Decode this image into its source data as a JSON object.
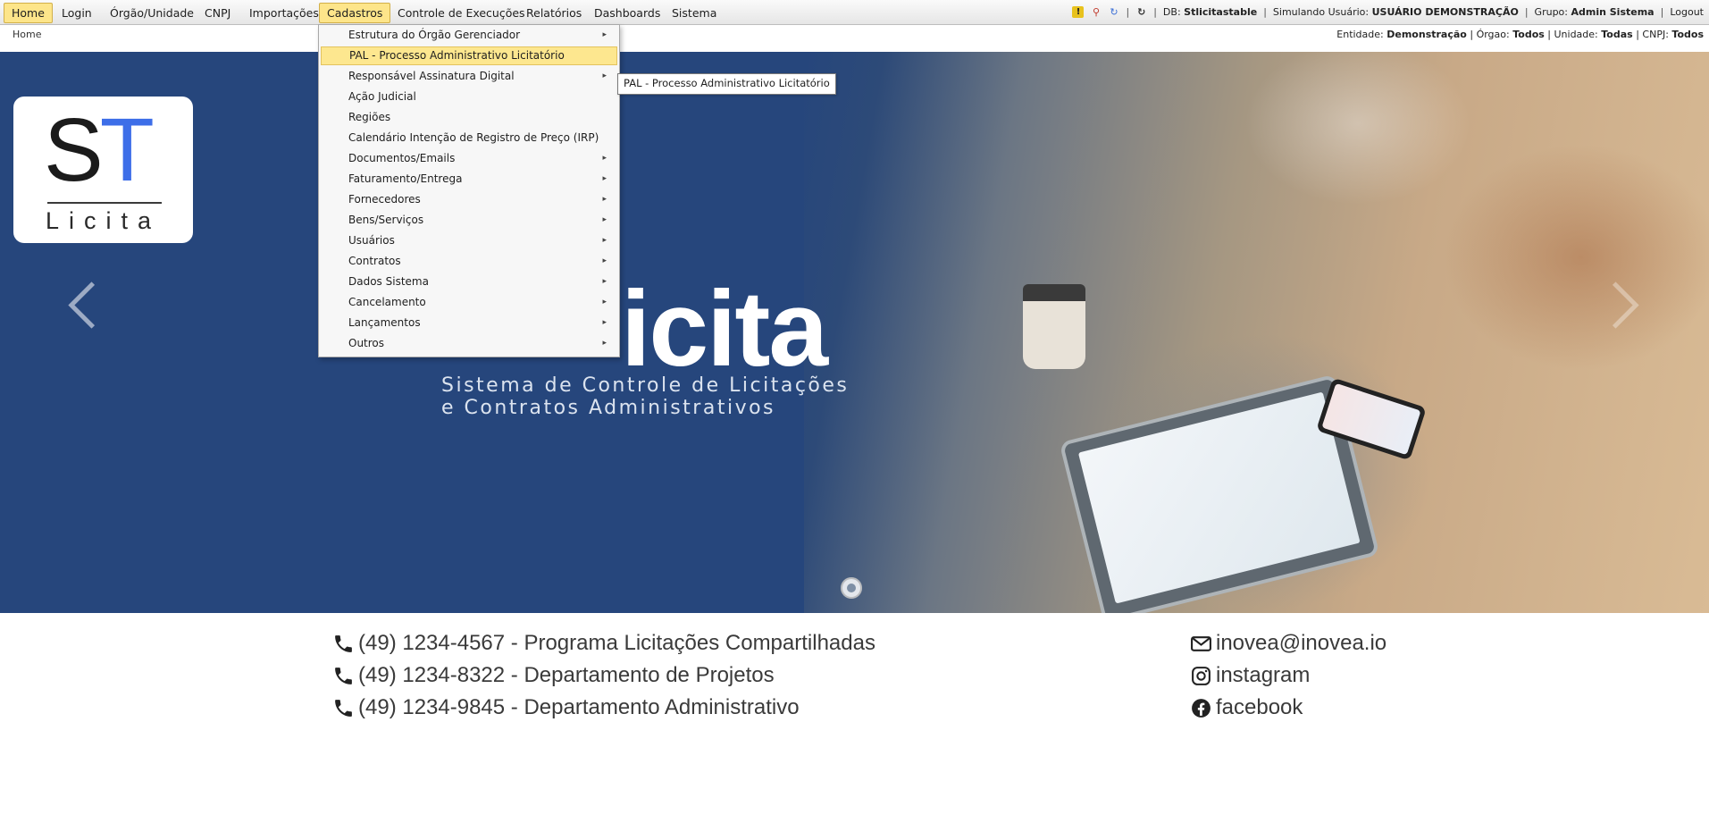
{
  "menu": {
    "items": [
      {
        "label": "Home"
      },
      {
        "label": "Login"
      },
      {
        "label": "Órgão/Unidade"
      },
      {
        "label": "CNPJ"
      },
      {
        "label": "Importações"
      },
      {
        "label": "Cadastros"
      },
      {
        "label": "Controle de Execuções"
      },
      {
        "label": "Relatórios"
      },
      {
        "label": "Dashboards"
      },
      {
        "label": "Sistema"
      }
    ]
  },
  "status": {
    "db_label": "DB:",
    "db_value": "Stlicitastable",
    "user_label": "Simulando Usuário:",
    "user_value": "USUÁRIO DEMONSTRAÇÃO",
    "group_label": "Grupo:",
    "group_value": "Admin Sistema",
    "logout": "Logout",
    "icons": [
      "warning-icon",
      "magnifier-icon",
      "sync-icon",
      "refresh-icon"
    ]
  },
  "breadcrumb": "Home",
  "context": {
    "entidade_label": "Entidade:",
    "entidade_value": "Demonstração",
    "orgao_label": "Órgao:",
    "orgao_value": "Todos",
    "unidade_label": "Unidade:",
    "unidade_value": "Todas",
    "cnpj_label": "CNPJ:",
    "cnpj_value": "Todos"
  },
  "dropdown": {
    "items": [
      {
        "label": "Estrutura do Órgão Gerenciador",
        "submenu": "▸"
      },
      {
        "label": "PAL - Processo Administrativo Licitatório",
        "submenu": ""
      },
      {
        "label": "Responsável Assinatura Digital",
        "submenu": "▸"
      },
      {
        "label": "Ação Judicial",
        "submenu": ""
      },
      {
        "label": "Regiões",
        "submenu": ""
      },
      {
        "label": "Calendário Intenção de Registro de Preço (IRP)",
        "submenu": ""
      },
      {
        "label": "Documentos/Emails",
        "submenu": "▸"
      },
      {
        "label": "Faturamento/Entrega",
        "submenu": "▸"
      },
      {
        "label": "Fornecedores",
        "submenu": "▸"
      },
      {
        "label": "Bens/Serviços",
        "submenu": "▸"
      },
      {
        "label": "Usuários",
        "submenu": "▸"
      },
      {
        "label": "Contratos",
        "submenu": "▸"
      },
      {
        "label": "Dados Sistema",
        "submenu": "▸"
      },
      {
        "label": "Cancelamento",
        "submenu": "▸"
      },
      {
        "label": "Lançamentos",
        "submenu": "▸"
      },
      {
        "label": "Outros",
        "submenu": "▸"
      }
    ]
  },
  "tooltip": "PAL - Processo Administrativo Licitatório",
  "hero": {
    "logo_letters_s": "S",
    "logo_letters_t": "T",
    "logo_word": "Licita",
    "title": "icita",
    "subtitle_line1": "Sistema de Controle de Licitações",
    "subtitle_line2": "e Contratos Administrativos"
  },
  "contacts": [
    {
      "text": "(49) 1234-4567 - Programa Licitações Compartilhadas"
    },
    {
      "text": "(49) 1234-8322 - Departamento de Projetos"
    },
    {
      "text": "(49) 1234-9845 - Departamento Administrativo"
    }
  ],
  "links": [
    {
      "text": "inovea@inovea.io",
      "icon": "envelope-icon"
    },
    {
      "text": "instagram",
      "icon": "instagram-icon"
    },
    {
      "text": "facebook",
      "icon": "facebook-icon"
    }
  ],
  "colors": {
    "hero_bg": "#26467c",
    "menu_active": "#fde58a",
    "logo_accent": "#3d6ee8"
  }
}
